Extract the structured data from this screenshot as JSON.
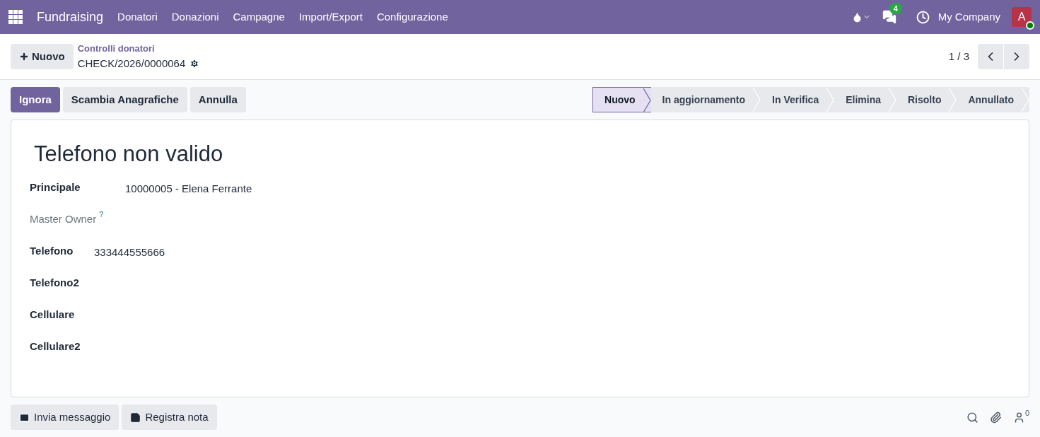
{
  "navbar": {
    "app": "Fundraising",
    "menu": [
      "Donatori",
      "Donazioni",
      "Campagne",
      "Import/Export",
      "Configurazione"
    ],
    "messages_badge": "4",
    "company": "My Company",
    "avatar": "A",
    "online": true
  },
  "control_panel": {
    "new_button": "Nuovo",
    "breadcrumb": "Controlli donatori",
    "record": "CHECK/2026/0000064",
    "pager": "1 / 3"
  },
  "actions": [
    {
      "label": "Ignora",
      "kind": "primary"
    },
    {
      "label": "Scambia Anagrafiche",
      "kind": "secondary"
    },
    {
      "label": "Annulla",
      "kind": "secondary"
    }
  ],
  "stages": [
    {
      "label": "Nuovo",
      "selected": true
    },
    {
      "label": "In aggiornamento",
      "selected": false
    },
    {
      "label": "In Verifica",
      "selected": false
    },
    {
      "label": "Elimina",
      "selected": false
    },
    {
      "label": "Risolto",
      "selected": false
    },
    {
      "label": "Annullato",
      "selected": false
    }
  ],
  "form": {
    "title": "Telefono non valido",
    "fields": [
      {
        "label": "Principale",
        "value": "10000005 - Elena Ferrante",
        "muted": false
      },
      {
        "label": "Master Owner",
        "help": "?",
        "muted": true
      },
      {
        "label": "Telefono",
        "value": "333444555666",
        "muted": false
      },
      {
        "label": "Telefono2",
        "muted": false
      },
      {
        "label": "Cellulare",
        "muted": false
      },
      {
        "label": "Cellulare2",
        "muted": false
      }
    ]
  },
  "chatter": {
    "buttons": [
      {
        "label": "Invia messaggio",
        "kind": "message"
      },
      {
        "label": "Registra nota",
        "kind": "note"
      }
    ],
    "followers": "0"
  }
}
